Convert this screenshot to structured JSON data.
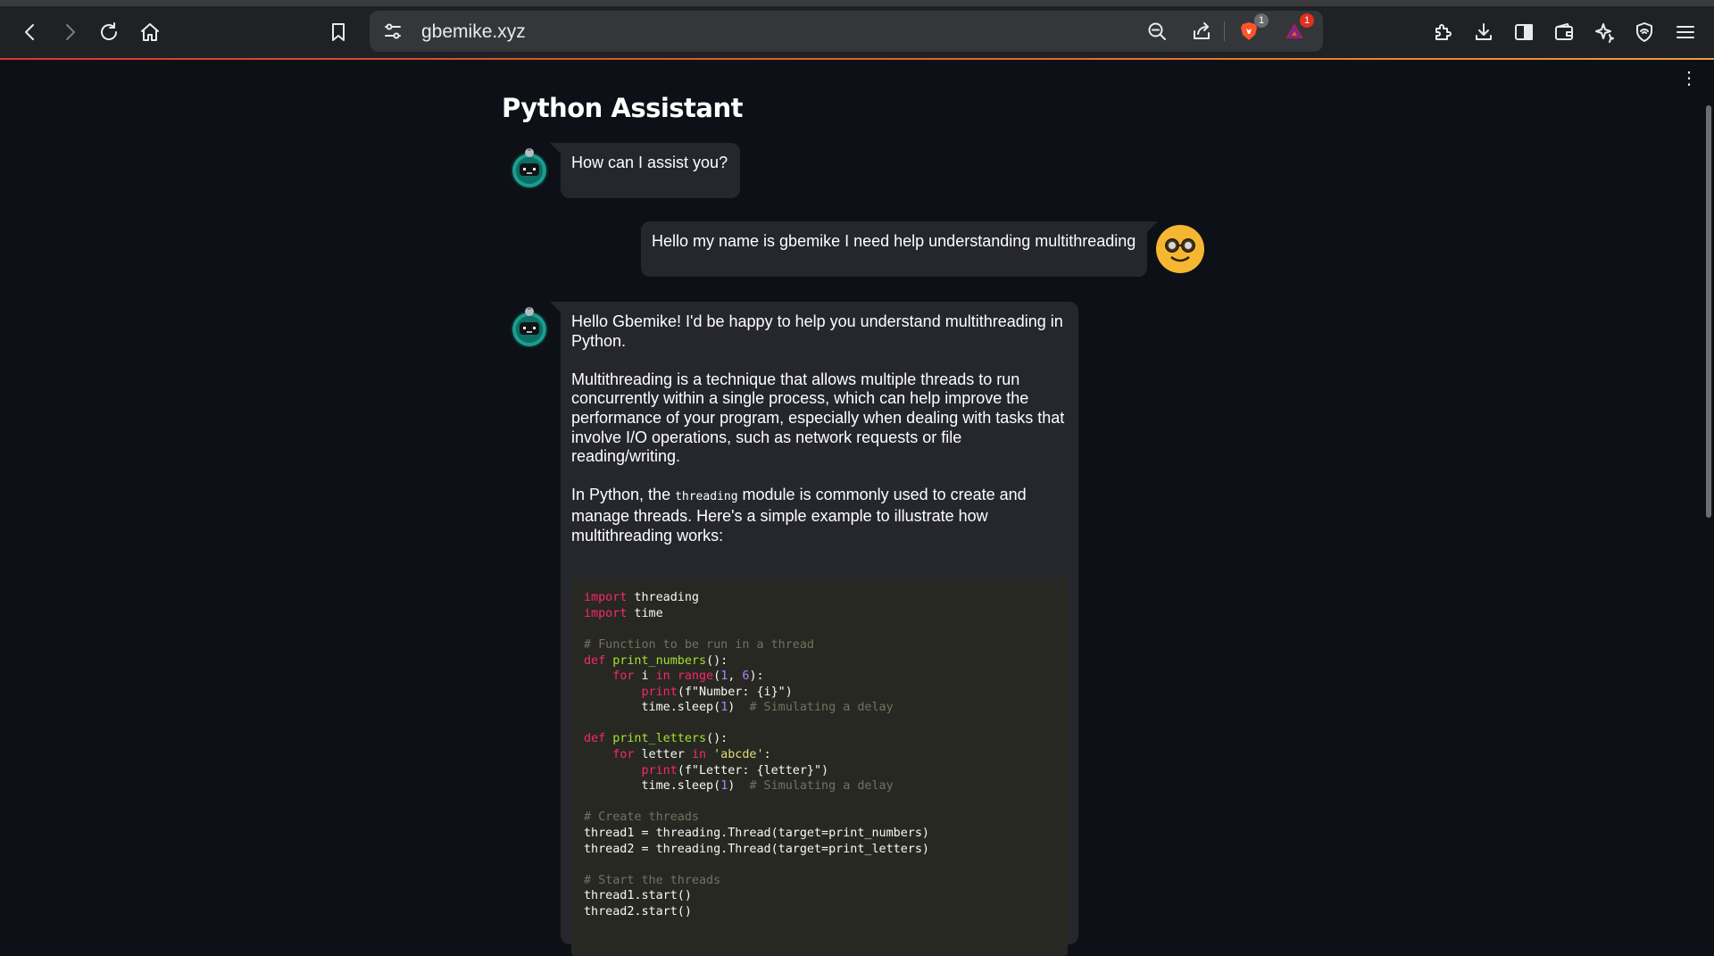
{
  "browser": {
    "url": "gbemike.xyz",
    "brave_shield_count": "1",
    "rewards_count": "1"
  },
  "page": {
    "title": "Python Assistant"
  },
  "messages": [
    {
      "role": "assistant",
      "paragraphs": [
        "How can I assist you?"
      ]
    },
    {
      "role": "user",
      "paragraphs": [
        "Hello my name is gbemike I need help understanding multithreading"
      ]
    },
    {
      "role": "assistant",
      "paragraphs": [
        "Hello Gbemike! I'd be happy to help you understand multithreading in Python.",
        "Multithreading is a technique that allows multiple threads to run concurrently within a single process, which can help improve the performance of your program, especially when dealing with tasks that involve I/O operations, such as network requests or file reading/writing."
      ],
      "para3_before": "In Python, the ",
      "para3_code": "threading",
      "para3_after": " module is commonly used to create and manage threads. Here's a simple example to illustrate how multithreading works:",
      "code_lines": [
        [
          [
            "kw",
            "import"
          ],
          [
            "plain",
            " threading"
          ]
        ],
        [
          [
            "kw",
            "import"
          ],
          [
            "plain",
            " time"
          ]
        ],
        [],
        [
          [
            "com",
            "# Function to be run in a thread"
          ]
        ],
        [
          [
            "kw",
            "def"
          ],
          [
            "plain",
            " "
          ],
          [
            "fn",
            "print_numbers"
          ],
          [
            "plain",
            "():"
          ]
        ],
        [
          [
            "plain",
            "    "
          ],
          [
            "kw",
            "for"
          ],
          [
            "plain",
            " i "
          ],
          [
            "kw",
            "in"
          ],
          [
            "plain",
            " "
          ],
          [
            "bi",
            "range"
          ],
          [
            "plain",
            "("
          ],
          [
            "num",
            "1"
          ],
          [
            "plain",
            ", "
          ],
          [
            "num",
            "6"
          ],
          [
            "plain",
            "):"
          ]
        ],
        [
          [
            "plain",
            "        "
          ],
          [
            "bi",
            "print"
          ],
          [
            "plain",
            "(f\"Number: {i}\")"
          ]
        ],
        [
          [
            "plain",
            "        time.sleep("
          ],
          [
            "num",
            "1"
          ],
          [
            "plain",
            ")  "
          ],
          [
            "com",
            "# Simulating a delay"
          ]
        ],
        [],
        [
          [
            "kw",
            "def"
          ],
          [
            "plain",
            " "
          ],
          [
            "fn",
            "print_letters"
          ],
          [
            "plain",
            "():"
          ]
        ],
        [
          [
            "plain",
            "    "
          ],
          [
            "kw",
            "for"
          ],
          [
            "plain",
            " letter "
          ],
          [
            "kw",
            "in"
          ],
          [
            "plain",
            " "
          ],
          [
            "str",
            "'abcde'"
          ],
          [
            "plain",
            ":"
          ]
        ],
        [
          [
            "plain",
            "        "
          ],
          [
            "bi",
            "print"
          ],
          [
            "plain",
            "(f\"Letter: {letter}\")"
          ]
        ],
        [
          [
            "plain",
            "        time.sleep("
          ],
          [
            "num",
            "1"
          ],
          [
            "plain",
            ")  "
          ],
          [
            "com",
            "# Simulating a delay"
          ]
        ],
        [],
        [
          [
            "com",
            "# Create threads"
          ]
        ],
        [
          [
            "plain",
            "thread1 = threading.Thread(target=print_numbers)"
          ]
        ],
        [
          [
            "plain",
            "thread2 = threading.Thread(target=print_letters)"
          ]
        ],
        [],
        [
          [
            "com",
            "# Start the threads"
          ]
        ],
        [
          [
            "plain",
            "thread1.start()"
          ]
        ],
        [
          [
            "plain",
            "thread2.start()"
          ]
        ]
      ]
    }
  ],
  "colors": {
    "page_bg": "#0d1117",
    "bubble_bg": "#25262e",
    "code_bg": "#272822",
    "user_avatar": "#f5b731",
    "bot_avatar": "#1a9e8f"
  },
  "icons": [
    "back-icon",
    "forward-icon",
    "reload-icon",
    "home-icon",
    "bookmark-icon",
    "site-settings-icon",
    "zoom-icon",
    "share-icon",
    "brave-shields-icon",
    "brave-rewards-icon",
    "extensions-icon",
    "downloads-icon",
    "sidebar-icon",
    "wallet-icon",
    "leo-ai-icon",
    "vpn-icon",
    "menu-icon"
  ]
}
